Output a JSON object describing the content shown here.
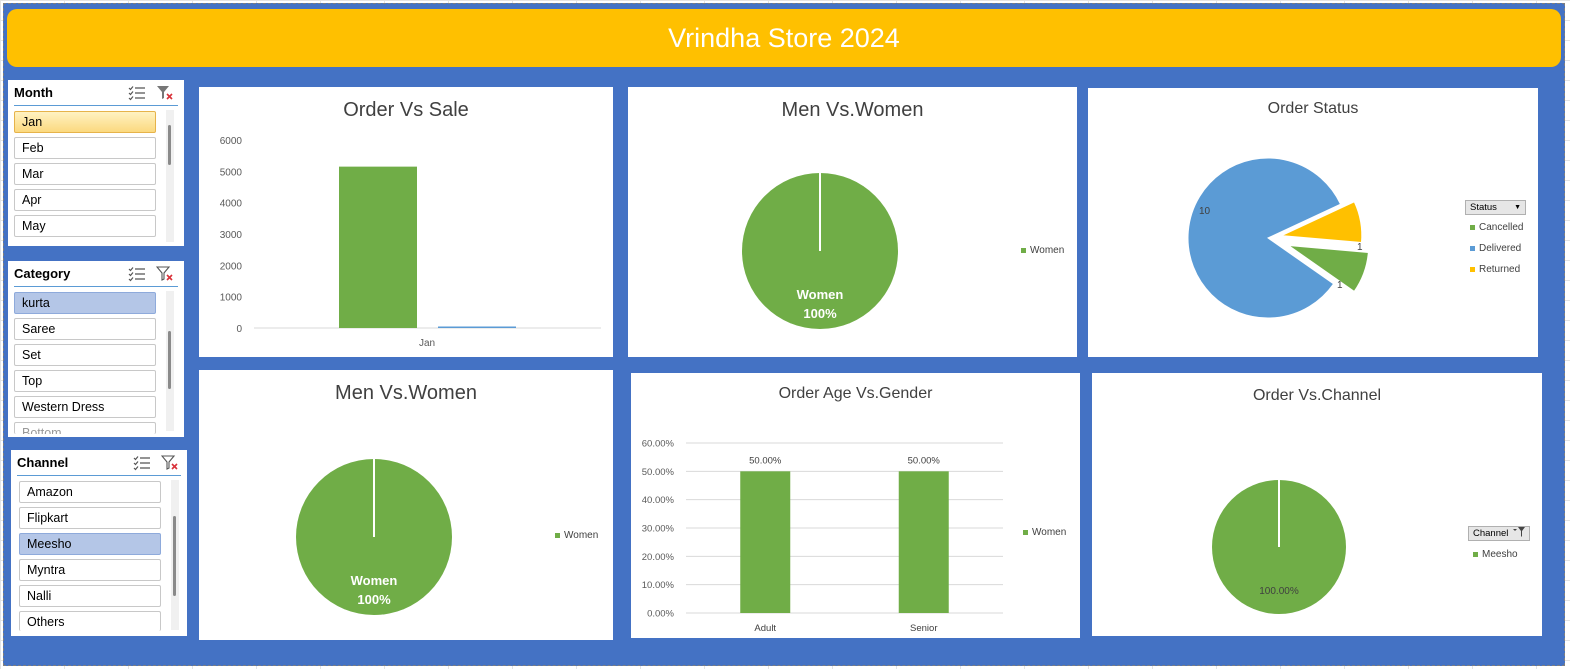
{
  "title": "Vrindha Store 2024",
  "colors": {
    "green": "#70ad47",
    "blue": "#5b9bd5",
    "gold": "#ffc000",
    "dash_bg": "#4472c4"
  },
  "slicers": {
    "month": {
      "title": "Month",
      "items": [
        "Jan",
        "Feb",
        "Mar",
        "Apr",
        "May"
      ],
      "selected": "Jan"
    },
    "category": {
      "title": "Category",
      "items": [
        "kurta",
        "Saree",
        "Set",
        "Top",
        "Western Dress",
        "Bottom"
      ],
      "selected": "kurta"
    },
    "channel": {
      "title": "Channel",
      "items": [
        "Amazon",
        "Flipkart",
        "Meesho",
        "Myntra",
        "Nalli",
        "Others"
      ],
      "selected": "Meesho"
    }
  },
  "charts": {
    "order_vs_sale": {
      "title": "Order Vs Sale",
      "ticks": [
        "0",
        "1000",
        "2000",
        "3000",
        "4000",
        "5000",
        "6000"
      ]
    },
    "men_vs_women_1": {
      "title": "Men Vs.Women",
      "slice_label": "Women",
      "slice_pct": "100%",
      "legend": "Women"
    },
    "order_status": {
      "title": "Order Status",
      "filter_label": "Status",
      "legend": [
        "Cancelled",
        "Delivered",
        "Returned"
      ],
      "labels": [
        "10",
        "1",
        "1"
      ]
    },
    "men_vs_women_2": {
      "title": "Men Vs.Women",
      "slice_label": "Women",
      "slice_pct": "100%",
      "legend": "Women"
    },
    "age_vs_gender": {
      "title": "Order Age Vs.Gender",
      "ticks": [
        "0.00%",
        "10.00%",
        "20.00%",
        "30.00%",
        "40.00%",
        "50.00%",
        "60.00%"
      ],
      "data_labels": [
        "50.00%",
        "50.00%"
      ],
      "legend": "Women"
    },
    "order_vs_channel": {
      "title": "Order Vs.Channel",
      "filter_label": "Channel",
      "legend": "Meesho",
      "slice_pct": "100.00%"
    }
  },
  "chart_data": [
    {
      "type": "bar",
      "title": "Order Vs Sale",
      "categories": [
        "Jan"
      ],
      "series": [
        {
          "values": [
            5150
          ]
        },
        {
          "values": [
            25
          ]
        }
      ],
      "ylim": [
        0,
        6000
      ],
      "grid": false
    },
    {
      "type": "pie",
      "title": "Men Vs.Women",
      "categories": [
        "Women"
      ],
      "values": [
        100
      ],
      "legend": "right"
    },
    {
      "type": "pie",
      "title": "Order Status",
      "categories": [
        "Cancelled",
        "Delivered",
        "Returned"
      ],
      "values": [
        1,
        10,
        1
      ],
      "legend": "right"
    },
    {
      "type": "pie",
      "title": "Men Vs.Women",
      "categories": [
        "Women"
      ],
      "values": [
        100
      ],
      "legend": "right"
    },
    {
      "type": "bar",
      "title": "Order Age Vs.Gender",
      "categories": [
        "Adult",
        "Senior"
      ],
      "series": [
        {
          "name": "Women",
          "values": [
            50,
            50
          ]
        }
      ],
      "ylim": [
        0,
        60
      ],
      "grid": true,
      "legend": "right"
    },
    {
      "type": "pie",
      "title": "Order Vs.Channel",
      "categories": [
        "Meesho"
      ],
      "values": [
        100
      ],
      "legend": "right"
    }
  ]
}
